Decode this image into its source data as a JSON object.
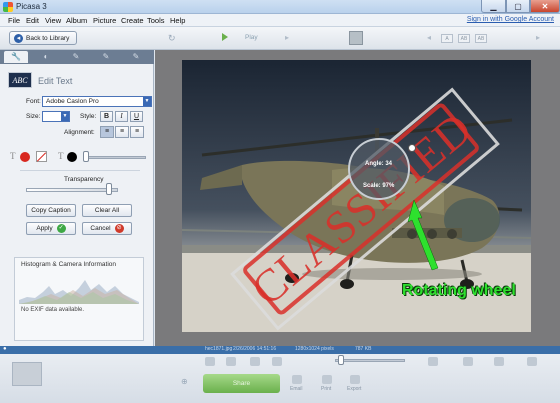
{
  "window": {
    "title": "Picasa 3"
  },
  "menu": {
    "items": [
      "File",
      "Edit",
      "View",
      "Album",
      "Picture",
      "Create",
      "Tools",
      "Help"
    ],
    "signin": "Sign in with Google Account"
  },
  "toolbar": {
    "back_label": "Back to Library",
    "play_label": "Play"
  },
  "panel": {
    "title": "Edit Text",
    "abc": "ABC",
    "font_label": "Font:",
    "font_value": "Adobe Caslon Pro",
    "size_label": "Size:",
    "style_label": "Style:",
    "style_buttons": [
      "B",
      "I",
      "U"
    ],
    "alignment_label": "Alignment:",
    "transparency_label": "Transparency",
    "transparency_level": 0.85,
    "buttons": {
      "caption": "Copy Caption",
      "clear": "Clear All",
      "apply": "Apply",
      "cancel": "Cancel"
    },
    "histogram_title": "Histogram & Camera Information",
    "exif": "No EXIF data available."
  },
  "photo": {
    "stamp_text": "CLASSIFIED",
    "angle": "Angle: 34",
    "scale": "Scale: 97%",
    "annotation": "Rotating wheel",
    "colors": {
      "stamp": "#d9302a",
      "annotation": "#2ee02e"
    }
  },
  "status": {
    "filename": "hec1871.jpg",
    "date": "2/26/2006 14:51:16",
    "dimensions": "1280x1024 pixels",
    "size": "787 KB"
  },
  "tray": {
    "share": "Share",
    "email": "Email",
    "print": "Print",
    "export": "Export"
  }
}
